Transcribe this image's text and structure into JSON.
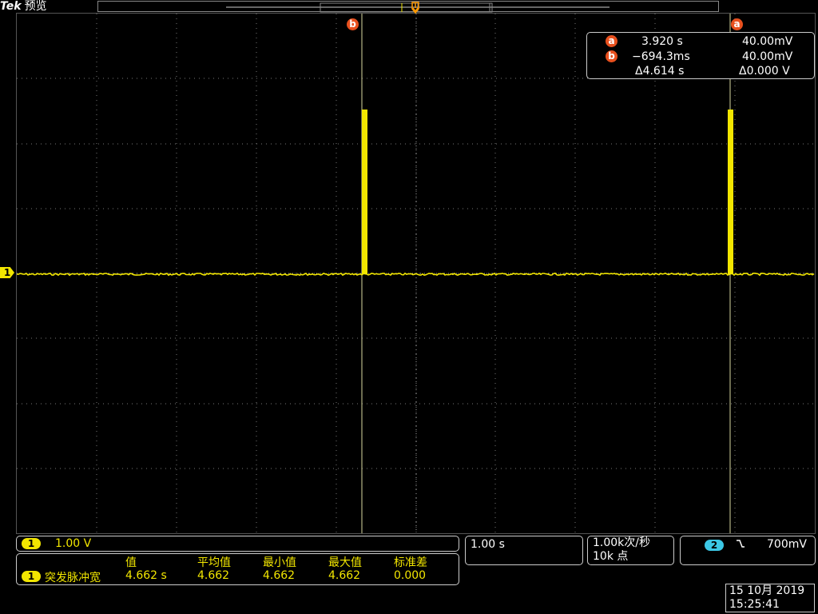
{
  "header": {
    "brand": "Tek",
    "mode": "预览"
  },
  "cursors": {
    "a_label": "a",
    "b_label": "b",
    "a_time": "3.920 s",
    "a_volt": "40.00mV",
    "b_time": "−694.3ms",
    "b_volt": "40.00mV",
    "delta_time": "Δ4.614 s",
    "delta_volt": "Δ0.000 V"
  },
  "channel1": {
    "marker": "1",
    "scale": "1.00 V"
  },
  "channel2": {
    "marker": "2",
    "trigger_level": "700mV"
  },
  "timebase": {
    "scale": "1.00 s"
  },
  "acquisition": {
    "rate": "1.00k次/秒",
    "record_length": "10k 点"
  },
  "measurement": {
    "headers": [
      "值",
      "平均值",
      "最小值",
      "最大值",
      "标准差"
    ],
    "name": "突发脉冲宽",
    "value": "4.662 s",
    "mean": "4.662",
    "min": "4.662",
    "max": "4.662",
    "std": "0.000"
  },
  "datetime": {
    "date": "15 10月 2019",
    "time": "15:25:41"
  },
  "colors": {
    "ch1": "#f2e600",
    "ch2": "#3cc8e6",
    "cursor_badge": "#e8501e",
    "trigger": "#ff9a00"
  },
  "icons": {
    "trigger_marker": "trigger-position-icon",
    "falling_edge": "falling-edge-icon"
  }
}
